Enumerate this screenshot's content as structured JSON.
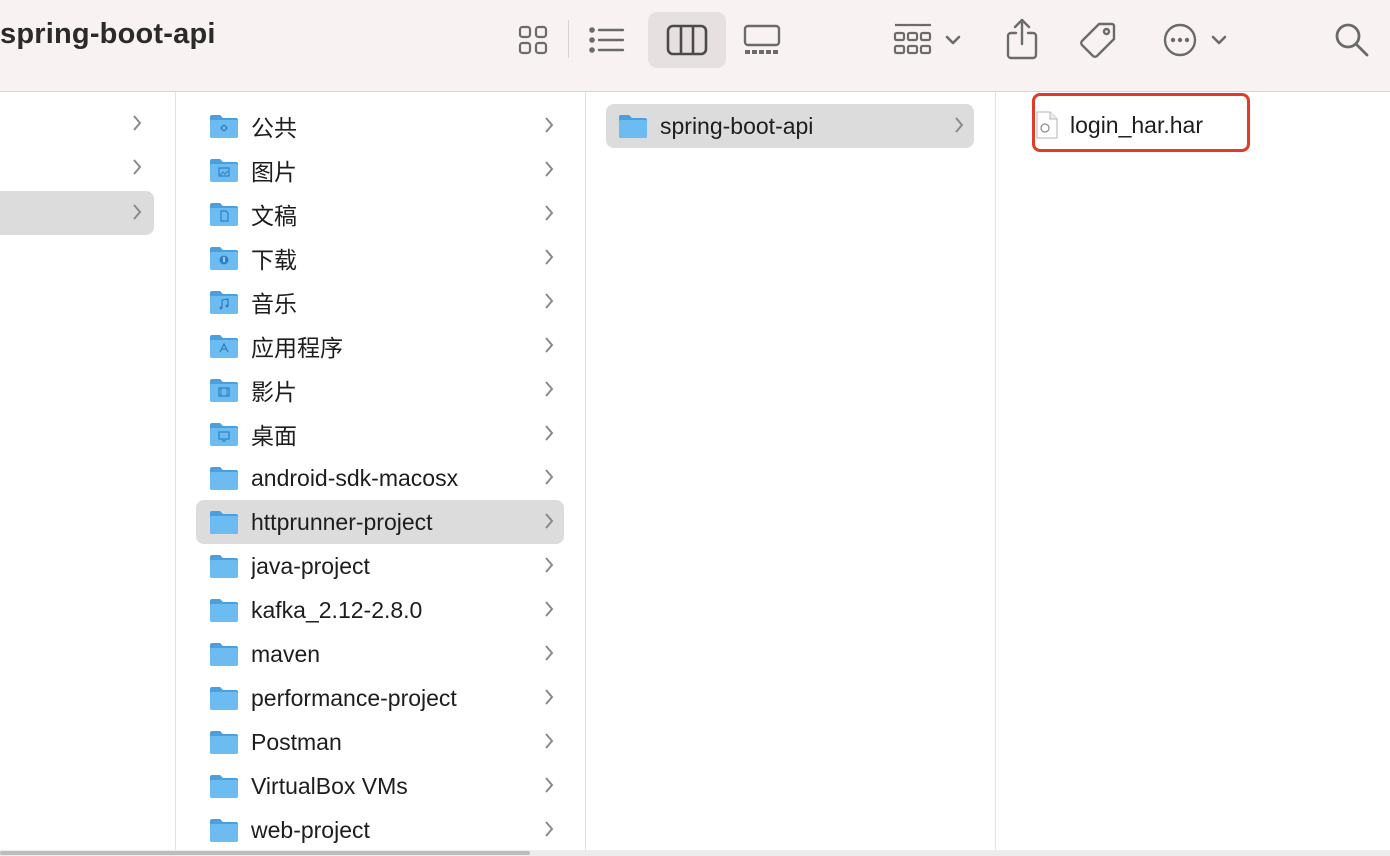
{
  "window": {
    "title": "spring-boot-api"
  },
  "toolbar": {
    "icons": [
      "icon-view-grid-icon",
      "list-view-icon",
      "column-view-icon",
      "gallery-view-icon",
      "group-by-icon",
      "share-icon",
      "tag-icon",
      "more-actions-icon",
      "search-icon"
    ],
    "selected_view": "column-view"
  },
  "column1": {
    "items": [
      {
        "label": ""
      },
      {
        "label": ""
      },
      {
        "label": "",
        "selected": true
      }
    ]
  },
  "column2": {
    "items": [
      {
        "label": "公共",
        "icon": "public-folder-icon"
      },
      {
        "label": "图片",
        "icon": "pictures-folder-icon"
      },
      {
        "label": "文稿",
        "icon": "documents-folder-icon"
      },
      {
        "label": "下载",
        "icon": "downloads-folder-icon"
      },
      {
        "label": "音乐",
        "icon": "music-folder-icon"
      },
      {
        "label": "应用程序",
        "icon": "applications-folder-icon"
      },
      {
        "label": "影片",
        "icon": "movies-folder-icon"
      },
      {
        "label": "桌面",
        "icon": "desktop-folder-icon"
      },
      {
        "label": "android-sdk-macosx",
        "icon": "folder-icon"
      },
      {
        "label": "httprunner-project",
        "icon": "folder-icon",
        "selected": true
      },
      {
        "label": "java-project",
        "icon": "folder-icon"
      },
      {
        "label": "kafka_2.12-2.8.0",
        "icon": "folder-icon"
      },
      {
        "label": "maven",
        "icon": "folder-icon"
      },
      {
        "label": "performance-project",
        "icon": "folder-icon"
      },
      {
        "label": "Postman",
        "icon": "folder-icon"
      },
      {
        "label": "VirtualBox VMs",
        "icon": "folder-icon"
      },
      {
        "label": "web-project",
        "icon": "folder-icon"
      }
    ]
  },
  "column3": {
    "items": [
      {
        "label": "spring-boot-api",
        "icon": "folder-icon",
        "selected": true
      }
    ]
  },
  "column4": {
    "files": [
      {
        "label": "login_har.har",
        "icon": "document-file-icon",
        "highlighted": true
      }
    ]
  },
  "colors": {
    "toolbar_bg": "#f8f3f2",
    "folder_blue": "#5fb0ec",
    "selection_gray": "#dcdcdc",
    "highlight_red": "#e23b2a"
  }
}
